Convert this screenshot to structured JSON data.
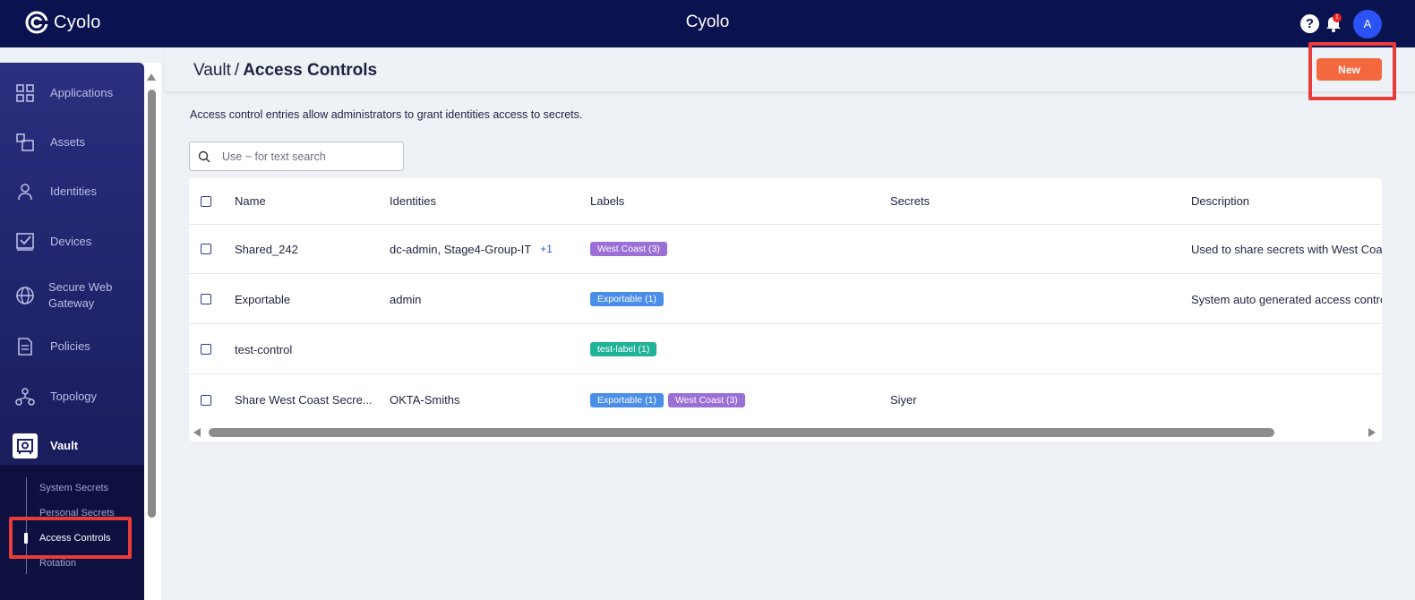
{
  "topbar": {
    "logo_text": "Cyolo",
    "app_title": "Cyolo",
    "notification_count": "1",
    "avatar_initial": "A",
    "help_label": "?"
  },
  "sidebar": {
    "items": [
      {
        "label": "Applications",
        "icon": "grid-icon"
      },
      {
        "label": "Assets",
        "icon": "assets-icon"
      },
      {
        "label": "Identities",
        "icon": "person-icon"
      },
      {
        "label": "Devices",
        "icon": "device-check-icon"
      },
      {
        "label": "Secure Web Gateway",
        "icon": "globe-icon"
      },
      {
        "label": "Policies",
        "icon": "document-icon"
      },
      {
        "label": "Topology",
        "icon": "topology-icon"
      },
      {
        "label": "Vault",
        "icon": "vault-icon"
      }
    ],
    "vault_subitems": [
      "System Secrets",
      "Personal Secrets",
      "Access Controls",
      "Rotation"
    ],
    "active_subitem": "Access Controls"
  },
  "header": {
    "breadcrumb_root": "Vault",
    "breadcrumb_sep": "/",
    "breadcrumb_current": "Access Controls",
    "new_button_label": "New"
  },
  "main": {
    "description": "Access control entries allow administrators to grant identities access to secrets.",
    "search_placeholder": "Use ~ for text search"
  },
  "table": {
    "columns": [
      "Name",
      "Identities",
      "Labels",
      "Secrets",
      "Description"
    ],
    "rows": [
      {
        "name": "Shared_242",
        "identities": "dc-admin, Stage4-Group-IT",
        "identities_more": "+1",
        "labels": [
          {
            "text": "West Coast (3)",
            "color": "#9b6fd6"
          }
        ],
        "secrets": "",
        "description": "Used to share secrets with West Coas"
      },
      {
        "name": "Exportable",
        "identities": "admin",
        "identities_more": "",
        "labels": [
          {
            "text": "Exportable (1)",
            "color": "#4a8ee8"
          }
        ],
        "secrets": "",
        "description": "System auto generated access contro"
      },
      {
        "name": "test-control",
        "identities": "",
        "identities_more": "",
        "labels": [
          {
            "text": "test-label (1)",
            "color": "#20b39a"
          }
        ],
        "secrets": "",
        "description": ""
      },
      {
        "name": "Share West Coast Secre...",
        "identities": "OKTA-Smiths",
        "identities_more": "",
        "labels": [
          {
            "text": "Exportable (1)",
            "color": "#4a8ee8"
          },
          {
            "text": "West Coast (3)",
            "color": "#9b6fd6"
          }
        ],
        "secrets": "Siyer",
        "description": ""
      }
    ]
  },
  "colors": {
    "topbar_bg": "#0b1250",
    "accent_new_button": "#f3683f",
    "highlight": "#ea3b3b"
  }
}
